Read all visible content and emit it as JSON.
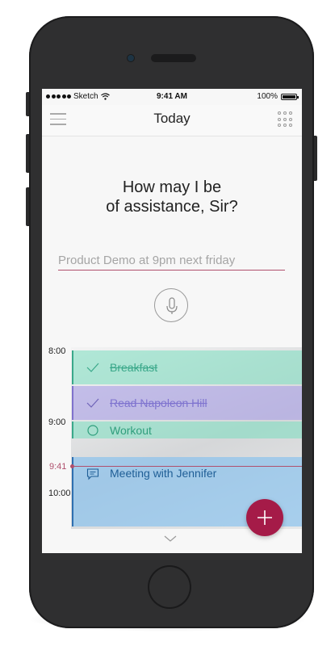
{
  "status_bar": {
    "carrier": "Sketch",
    "time": "9:41 AM",
    "battery": "100%"
  },
  "navbar": {
    "title": "Today"
  },
  "assistant": {
    "prompt_line1": "How may I be",
    "prompt_line2": "of assistance, Sir?"
  },
  "input": {
    "placeholder": "Product Demo at 9pm next friday"
  },
  "timeline": {
    "hours": [
      "8:00",
      "9:00",
      "10:00"
    ],
    "current_time": "9:41",
    "events": [
      {
        "title": "Breakfast",
        "state": "done",
        "color": "#7adec0"
      },
      {
        "title": "Read Napoleon Hill",
        "state": "done",
        "color": "#a89ee6"
      },
      {
        "title": "Workout",
        "state": "pending",
        "color": "#7adec0"
      },
      {
        "title": "Meeting with Jennifer",
        "state": "note",
        "color": "#7dbef0"
      }
    ]
  },
  "icons": {
    "menu": "hamburger-icon",
    "apps": "grid-icon",
    "mic": "microphone-icon",
    "check": "checkmark-icon",
    "circle": "circle-icon",
    "comment": "comment-icon",
    "add": "plus-icon",
    "chevron": "chevron-down-icon"
  },
  "colors": {
    "accent": "#a51b48",
    "now_line": "#b0506d"
  }
}
